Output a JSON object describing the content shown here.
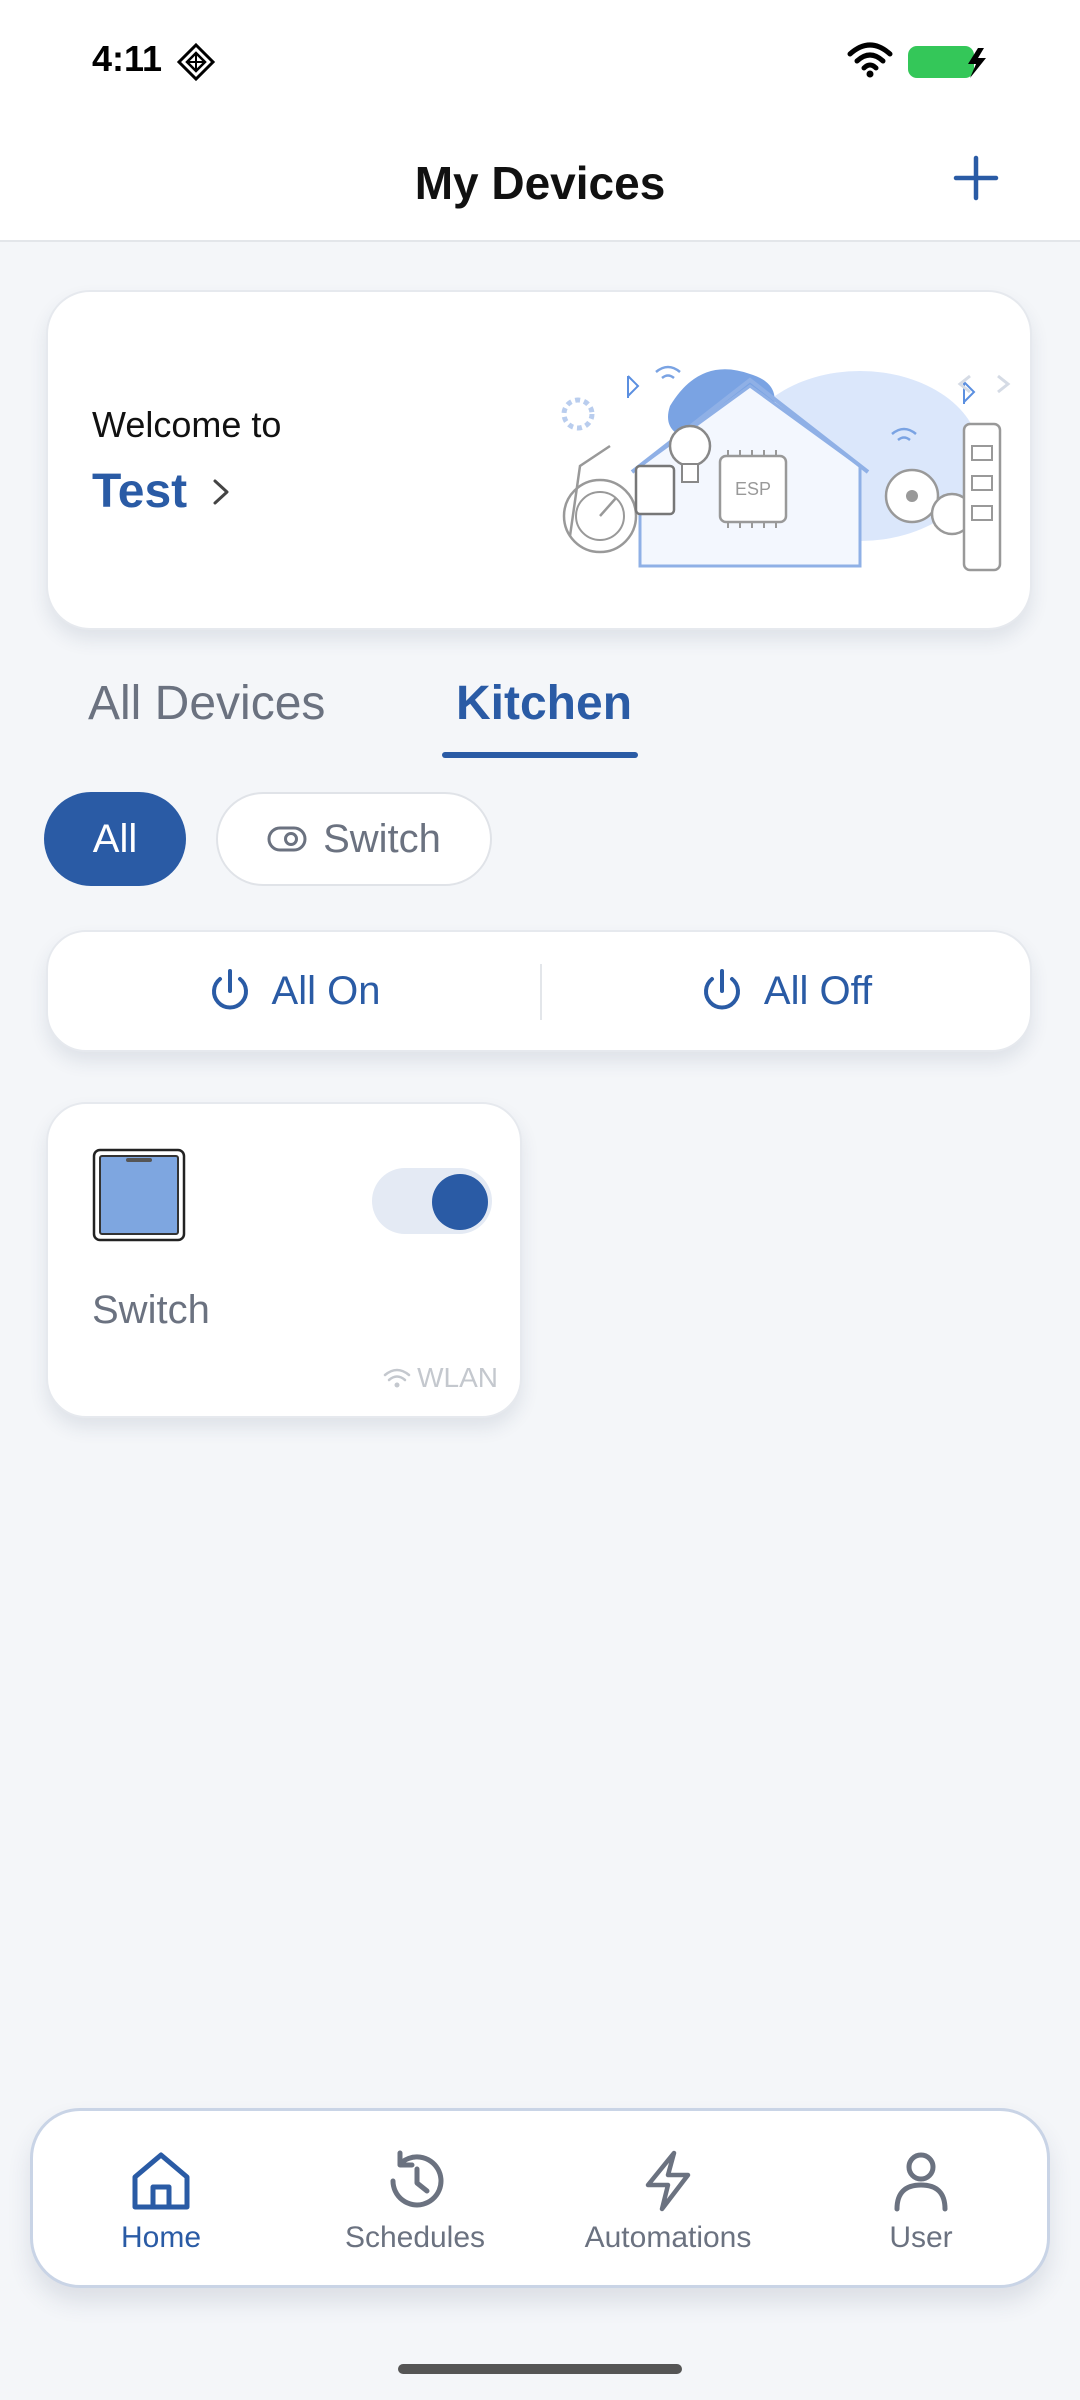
{
  "status_bar": {
    "time": "4:11"
  },
  "header": {
    "title": "My Devices"
  },
  "welcome": {
    "label": "Welcome to",
    "home_name": "Test"
  },
  "tabs": [
    {
      "label": "All Devices",
      "active": false
    },
    {
      "label": "Kitchen",
      "active": true
    }
  ],
  "filters": [
    {
      "label": "All",
      "selected": true
    },
    {
      "label": "Switch",
      "selected": false
    }
  ],
  "power_controls": {
    "all_on": "All On",
    "all_off": "All Off"
  },
  "devices": [
    {
      "name": "Switch",
      "connection": "WLAN",
      "on": true
    }
  ],
  "nav": [
    {
      "label": "Home",
      "icon": "home-icon",
      "active": true
    },
    {
      "label": "Schedules",
      "icon": "history-icon",
      "active": false
    },
    {
      "label": "Automations",
      "icon": "lightning-icon",
      "active": false
    },
    {
      "label": "User",
      "icon": "user-icon",
      "active": false
    }
  ],
  "colors": {
    "accent": "#2a5ba5",
    "background": "#f4f6f9",
    "battery": "#34c759"
  }
}
